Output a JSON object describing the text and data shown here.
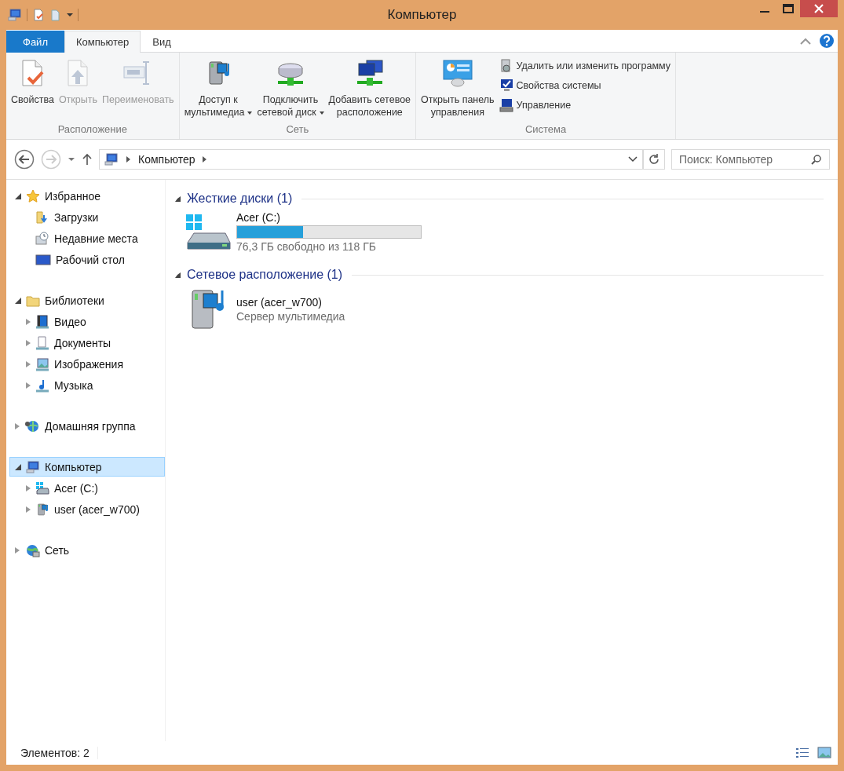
{
  "window": {
    "title": "Компьютер"
  },
  "ribbon": {
    "tabs": [
      {
        "label": "Файл",
        "kind": "file",
        "selected": false
      },
      {
        "label": "Компьютер",
        "kind": "tab",
        "selected": true
      },
      {
        "label": "Вид",
        "kind": "tab",
        "selected": false
      }
    ],
    "groups": [
      {
        "label": "Расположение",
        "buttons": [
          {
            "label": "Свойства",
            "kind": "large",
            "disabled": false,
            "dropdown": false
          },
          {
            "label": "Открыть",
            "kind": "large",
            "disabled": true,
            "dropdown": false
          },
          {
            "label": "Переименовать",
            "kind": "large",
            "disabled": true,
            "dropdown": false
          }
        ]
      },
      {
        "label": "Сеть",
        "buttons": [
          {
            "label": "Доступ к\nмультимедиа",
            "kind": "large",
            "disabled": false,
            "dropdown": true
          },
          {
            "label": "Подключить\nсетевой диск",
            "kind": "large",
            "disabled": false,
            "dropdown": true
          },
          {
            "label": "Добавить сетевое\nрасположение",
            "kind": "large",
            "disabled": false,
            "dropdown": false
          }
        ]
      },
      {
        "label": "Система",
        "buttons": [
          {
            "label": "Открыть панель\nуправления",
            "kind": "large",
            "disabled": false,
            "dropdown": false
          },
          {
            "label": "Удалить или изменить программу",
            "kind": "small",
            "disabled": false,
            "dropdown": false
          },
          {
            "label": "Свойства системы",
            "kind": "small",
            "disabled": false,
            "dropdown": false
          },
          {
            "label": "Управление",
            "kind": "small",
            "disabled": false,
            "dropdown": false
          }
        ]
      }
    ]
  },
  "address": {
    "segments": [
      "Компьютер"
    ],
    "search_placeholder": "Поиск: Компьютер"
  },
  "navigation": [
    {
      "label": "Избранное",
      "expanded": true,
      "selected": false,
      "children": [
        {
          "label": "Загрузки",
          "selected": false
        },
        {
          "label": "Недавние места",
          "selected": false
        },
        {
          "label": "Рабочий стол",
          "selected": false
        }
      ]
    },
    {
      "label": "Библиотеки",
      "expanded": true,
      "selected": false,
      "children": [
        {
          "label": "Видео",
          "expanded": false,
          "selected": false
        },
        {
          "label": "Документы",
          "expanded": false,
          "selected": false
        },
        {
          "label": "Изображения",
          "expanded": false,
          "selected": false
        },
        {
          "label": "Музыка",
          "expanded": false,
          "selected": false
        }
      ]
    },
    {
      "label": "Домашняя группа",
      "expanded": false,
      "selected": false
    },
    {
      "label": "Компьютер",
      "expanded": true,
      "selected": true,
      "children": [
        {
          "label": "Acer (C:)",
          "expanded": false,
          "selected": false
        },
        {
          "label": "user (acer_w700)",
          "expanded": false,
          "selected": false
        }
      ]
    },
    {
      "label": "Сеть",
      "expanded": false,
      "selected": false
    }
  ],
  "sections": [
    {
      "title": "Жесткие диски (1)",
      "expanded": true,
      "items": [
        {
          "kind": "drive",
          "name": "Acer (C:)",
          "level": 0.36,
          "detail": "76,3 ГБ свободно из 118 ГБ"
        }
      ]
    },
    {
      "title": "Сетевое расположение (1)",
      "expanded": true,
      "items": [
        {
          "kind": "media-server",
          "name": "user (acer_w700)",
          "detail": "Сервер мультимедиа"
        }
      ]
    }
  ],
  "status_bar": {
    "text": "Элементов: 2"
  }
}
